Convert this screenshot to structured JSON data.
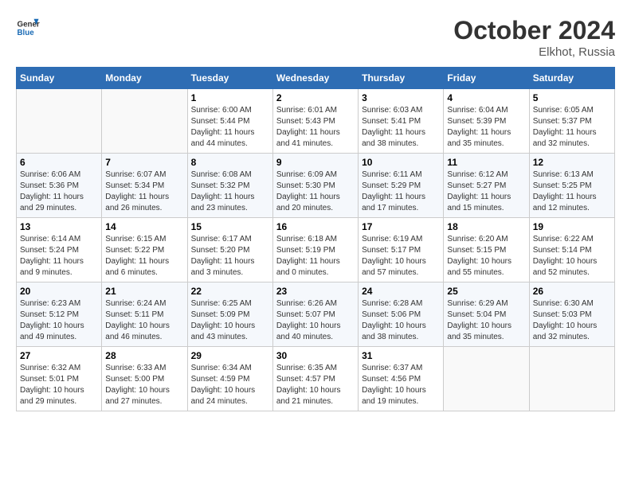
{
  "header": {
    "logo_text_general": "General",
    "logo_text_blue": "Blue",
    "month": "October 2024",
    "location": "Elkhot, Russia"
  },
  "weekdays": [
    "Sunday",
    "Monday",
    "Tuesday",
    "Wednesday",
    "Thursday",
    "Friday",
    "Saturday"
  ],
  "weeks": [
    [
      {
        "day": "",
        "sunrise": "",
        "sunset": "",
        "daylight": ""
      },
      {
        "day": "",
        "sunrise": "",
        "sunset": "",
        "daylight": ""
      },
      {
        "day": "1",
        "sunrise": "Sunrise: 6:00 AM",
        "sunset": "Sunset: 5:44 PM",
        "daylight": "Daylight: 11 hours and 44 minutes."
      },
      {
        "day": "2",
        "sunrise": "Sunrise: 6:01 AM",
        "sunset": "Sunset: 5:43 PM",
        "daylight": "Daylight: 11 hours and 41 minutes."
      },
      {
        "day": "3",
        "sunrise": "Sunrise: 6:03 AM",
        "sunset": "Sunset: 5:41 PM",
        "daylight": "Daylight: 11 hours and 38 minutes."
      },
      {
        "day": "4",
        "sunrise": "Sunrise: 6:04 AM",
        "sunset": "Sunset: 5:39 PM",
        "daylight": "Daylight: 11 hours and 35 minutes."
      },
      {
        "day": "5",
        "sunrise": "Sunrise: 6:05 AM",
        "sunset": "Sunset: 5:37 PM",
        "daylight": "Daylight: 11 hours and 32 minutes."
      }
    ],
    [
      {
        "day": "6",
        "sunrise": "Sunrise: 6:06 AM",
        "sunset": "Sunset: 5:36 PM",
        "daylight": "Daylight: 11 hours and 29 minutes."
      },
      {
        "day": "7",
        "sunrise": "Sunrise: 6:07 AM",
        "sunset": "Sunset: 5:34 PM",
        "daylight": "Daylight: 11 hours and 26 minutes."
      },
      {
        "day": "8",
        "sunrise": "Sunrise: 6:08 AM",
        "sunset": "Sunset: 5:32 PM",
        "daylight": "Daylight: 11 hours and 23 minutes."
      },
      {
        "day": "9",
        "sunrise": "Sunrise: 6:09 AM",
        "sunset": "Sunset: 5:30 PM",
        "daylight": "Daylight: 11 hours and 20 minutes."
      },
      {
        "day": "10",
        "sunrise": "Sunrise: 6:11 AM",
        "sunset": "Sunset: 5:29 PM",
        "daylight": "Daylight: 11 hours and 17 minutes."
      },
      {
        "day": "11",
        "sunrise": "Sunrise: 6:12 AM",
        "sunset": "Sunset: 5:27 PM",
        "daylight": "Daylight: 11 hours and 15 minutes."
      },
      {
        "day": "12",
        "sunrise": "Sunrise: 6:13 AM",
        "sunset": "Sunset: 5:25 PM",
        "daylight": "Daylight: 11 hours and 12 minutes."
      }
    ],
    [
      {
        "day": "13",
        "sunrise": "Sunrise: 6:14 AM",
        "sunset": "Sunset: 5:24 PM",
        "daylight": "Daylight: 11 hours and 9 minutes."
      },
      {
        "day": "14",
        "sunrise": "Sunrise: 6:15 AM",
        "sunset": "Sunset: 5:22 PM",
        "daylight": "Daylight: 11 hours and 6 minutes."
      },
      {
        "day": "15",
        "sunrise": "Sunrise: 6:17 AM",
        "sunset": "Sunset: 5:20 PM",
        "daylight": "Daylight: 11 hours and 3 minutes."
      },
      {
        "day": "16",
        "sunrise": "Sunrise: 6:18 AM",
        "sunset": "Sunset: 5:19 PM",
        "daylight": "Daylight: 11 hours and 0 minutes."
      },
      {
        "day": "17",
        "sunrise": "Sunrise: 6:19 AM",
        "sunset": "Sunset: 5:17 PM",
        "daylight": "Daylight: 10 hours and 57 minutes."
      },
      {
        "day": "18",
        "sunrise": "Sunrise: 6:20 AM",
        "sunset": "Sunset: 5:15 PM",
        "daylight": "Daylight: 10 hours and 55 minutes."
      },
      {
        "day": "19",
        "sunrise": "Sunrise: 6:22 AM",
        "sunset": "Sunset: 5:14 PM",
        "daylight": "Daylight: 10 hours and 52 minutes."
      }
    ],
    [
      {
        "day": "20",
        "sunrise": "Sunrise: 6:23 AM",
        "sunset": "Sunset: 5:12 PM",
        "daylight": "Daylight: 10 hours and 49 minutes."
      },
      {
        "day": "21",
        "sunrise": "Sunrise: 6:24 AM",
        "sunset": "Sunset: 5:11 PM",
        "daylight": "Daylight: 10 hours and 46 minutes."
      },
      {
        "day": "22",
        "sunrise": "Sunrise: 6:25 AM",
        "sunset": "Sunset: 5:09 PM",
        "daylight": "Daylight: 10 hours and 43 minutes."
      },
      {
        "day": "23",
        "sunrise": "Sunrise: 6:26 AM",
        "sunset": "Sunset: 5:07 PM",
        "daylight": "Daylight: 10 hours and 40 minutes."
      },
      {
        "day": "24",
        "sunrise": "Sunrise: 6:28 AM",
        "sunset": "Sunset: 5:06 PM",
        "daylight": "Daylight: 10 hours and 38 minutes."
      },
      {
        "day": "25",
        "sunrise": "Sunrise: 6:29 AM",
        "sunset": "Sunset: 5:04 PM",
        "daylight": "Daylight: 10 hours and 35 minutes."
      },
      {
        "day": "26",
        "sunrise": "Sunrise: 6:30 AM",
        "sunset": "Sunset: 5:03 PM",
        "daylight": "Daylight: 10 hours and 32 minutes."
      }
    ],
    [
      {
        "day": "27",
        "sunrise": "Sunrise: 6:32 AM",
        "sunset": "Sunset: 5:01 PM",
        "daylight": "Daylight: 10 hours and 29 minutes."
      },
      {
        "day": "28",
        "sunrise": "Sunrise: 6:33 AM",
        "sunset": "Sunset: 5:00 PM",
        "daylight": "Daylight: 10 hours and 27 minutes."
      },
      {
        "day": "29",
        "sunrise": "Sunrise: 6:34 AM",
        "sunset": "Sunset: 4:59 PM",
        "daylight": "Daylight: 10 hours and 24 minutes."
      },
      {
        "day": "30",
        "sunrise": "Sunrise: 6:35 AM",
        "sunset": "Sunset: 4:57 PM",
        "daylight": "Daylight: 10 hours and 21 minutes."
      },
      {
        "day": "31",
        "sunrise": "Sunrise: 6:37 AM",
        "sunset": "Sunset: 4:56 PM",
        "daylight": "Daylight: 10 hours and 19 minutes."
      },
      {
        "day": "",
        "sunrise": "",
        "sunset": "",
        "daylight": ""
      },
      {
        "day": "",
        "sunrise": "",
        "sunset": "",
        "daylight": ""
      }
    ]
  ]
}
